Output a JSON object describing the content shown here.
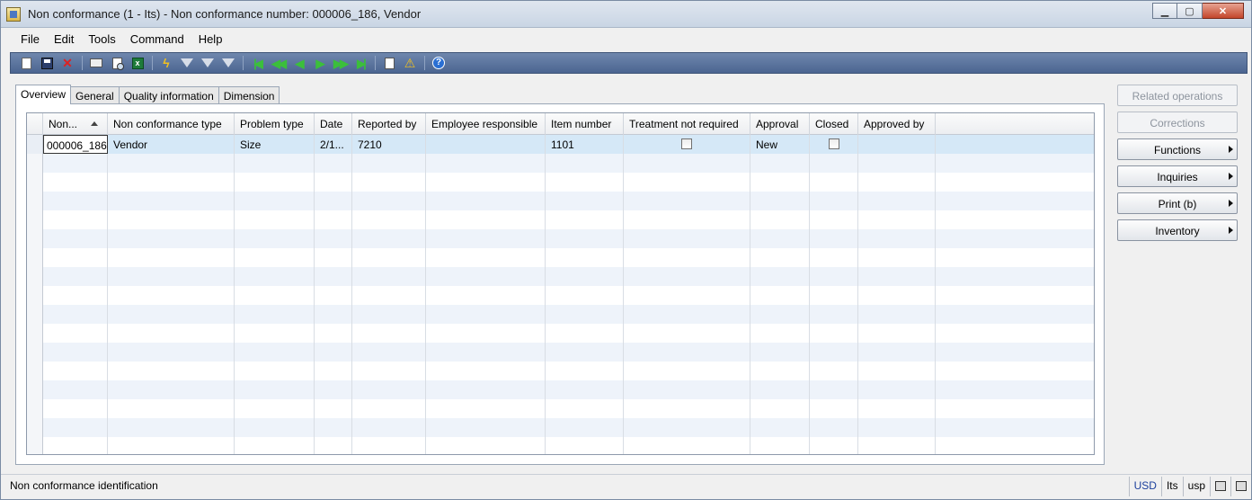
{
  "window": {
    "title": "Non conformance (1 - Its) - Non conformance number: 000006_186, Vendor",
    "minimize_icon": "minimize-icon",
    "maximize_icon": "maximize-icon",
    "close_icon": "close-icon"
  },
  "menu": [
    "File",
    "Edit",
    "Tools",
    "Command",
    "Help"
  ],
  "toolbar": {
    "icons": [
      "new-icon",
      "save-icon",
      "delete-icon",
      "print-icon",
      "print-preview-icon",
      "export-excel-icon",
      "filter-by-selection-icon",
      "filter-by-grid-icon",
      "advanced-filter-icon",
      "remove-filter-icon",
      "first-record-icon",
      "previous-page-icon",
      "previous-record-icon",
      "next-record-icon",
      "next-page-icon",
      "last-record-icon",
      "document-handling-icon",
      "alert-icon",
      "help-icon"
    ]
  },
  "tabs": [
    "Overview",
    "General",
    "Quality information",
    "Dimension"
  ],
  "active_tab": "Overview",
  "grid": {
    "columns": [
      "Non...",
      "Non conformance type",
      "Problem type",
      "Date",
      "Reported by",
      "Employee responsible",
      "Item number",
      "Treatment not required",
      "Approval",
      "Closed",
      "Approved by"
    ],
    "sorted_column": "Non...",
    "sort_direction": "ascending",
    "rows": [
      {
        "non_conformance": "000006_186",
        "type": "Vendor",
        "problem_type": "Size",
        "date": "2/1...",
        "reported_by": "7210",
        "employee_responsible": "",
        "item_number": "1101",
        "treatment_not_required": false,
        "approval": "New",
        "closed": false,
        "approved_by": ""
      }
    ]
  },
  "side_buttons": {
    "related_operations": "Related operations",
    "corrections": "Corrections",
    "functions": "Functions",
    "inquiries": "Inquiries",
    "print": "Print (b)",
    "inventory": "Inventory"
  },
  "status": {
    "text": "Non conformance identification",
    "currency": "USD",
    "company": "Its",
    "layer": "usp"
  }
}
